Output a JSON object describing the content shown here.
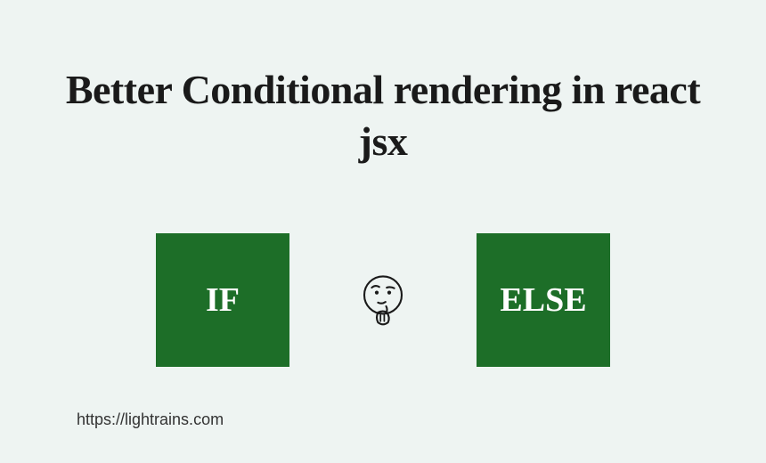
{
  "title": "Better Conditional rendering in react jsx",
  "if_box": {
    "label": "IF"
  },
  "else_box": {
    "label": "ELSE"
  },
  "url_text": "https://lightrains.com",
  "colors": {
    "background": "#eef4f2",
    "box_bg": "#1d6e28",
    "box_text": "#ffffff",
    "title_text": "#1a1a1a"
  }
}
